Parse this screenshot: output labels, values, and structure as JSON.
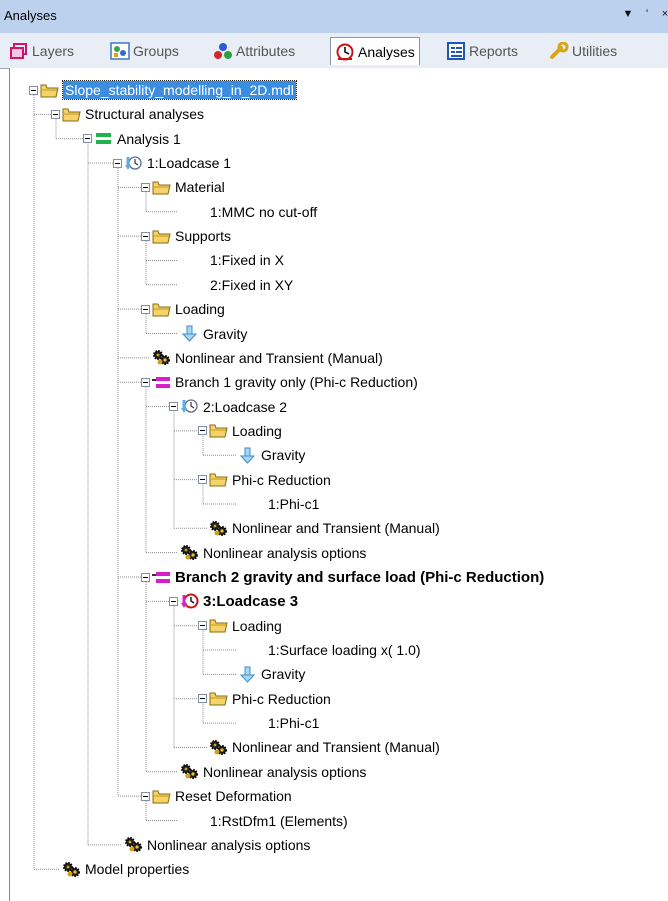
{
  "window": {
    "title": "Analyses",
    "buttons": [
      "▼",
      "'",
      "×"
    ]
  },
  "tabs": [
    {
      "label": "Layers",
      "icon": "layers-icon",
      "active": false
    },
    {
      "label": "Groups",
      "icon": "groups-icon",
      "active": false
    },
    {
      "label": "Attributes",
      "icon": "attributes-icon",
      "active": false
    },
    {
      "label": "Analyses",
      "icon": "analyses-icon",
      "active": true
    },
    {
      "label": "Reports",
      "icon": "reports-icon",
      "active": false
    },
    {
      "label": "Utilities",
      "icon": "utilities-icon",
      "active": false
    }
  ],
  "tree": [
    {
      "label": "Slope_stability_modelling_in_2D.mdl",
      "icon": "folder-icon",
      "expanded": true,
      "selected": true
    },
    {
      "label": "Structural analyses",
      "icon": "folder-icon",
      "expanded": true
    },
    {
      "label": "Analysis 1",
      "icon": "analysis-icon",
      "expanded": true
    },
    {
      "label": "1:Loadcase 1",
      "icon": "loadcase-icon",
      "expanded": true
    },
    {
      "label": "Material",
      "icon": "folder-icon",
      "expanded": true
    },
    {
      "label": "1:MMC no cut-off",
      "icon": "none"
    },
    {
      "label": "Supports",
      "icon": "folder-icon",
      "expanded": true
    },
    {
      "label": "1:Fixed in X",
      "icon": "none"
    },
    {
      "label": "2:Fixed in XY",
      "icon": "none"
    },
    {
      "label": "Loading",
      "icon": "folder-icon",
      "expanded": true
    },
    {
      "label": "Gravity",
      "icon": "gravity-icon"
    },
    {
      "label": "Nonlinear and Transient (Manual)",
      "icon": "gears-icon"
    },
    {
      "label": "Branch 1 gravity only (Phi-c Reduction)",
      "icon": "branch-icon",
      "expanded": true
    },
    {
      "label": "2:Loadcase 2",
      "icon": "loadcase-icon",
      "expanded": true
    },
    {
      "label": "Loading",
      "icon": "folder-icon",
      "expanded": true
    },
    {
      "label": "Gravity",
      "icon": "gravity-icon"
    },
    {
      "label": "Phi-c Reduction",
      "icon": "folder-icon",
      "expanded": true
    },
    {
      "label": "1:Phi-c1",
      "icon": "none"
    },
    {
      "label": "Nonlinear and Transient (Manual)",
      "icon": "gears-icon"
    },
    {
      "label": "Nonlinear analysis options",
      "icon": "gears-icon"
    },
    {
      "label": "Branch 2 gravity and surface load (Phi-c Reduction)",
      "icon": "branch-icon",
      "expanded": true,
      "bold": true
    },
    {
      "label": "3:Loadcase 3",
      "icon": "loadcase-active-icon",
      "expanded": true,
      "bold": true
    },
    {
      "label": "Loading",
      "icon": "folder-icon",
      "expanded": true
    },
    {
      "label": "1:Surface loading x( 1.0)",
      "icon": "none"
    },
    {
      "label": "Gravity",
      "icon": "gravity-icon"
    },
    {
      "label": "Phi-c Reduction",
      "icon": "folder-icon",
      "expanded": true
    },
    {
      "label": "1:Phi-c1",
      "icon": "none"
    },
    {
      "label": "Nonlinear and Transient (Manual)",
      "icon": "gears-icon"
    },
    {
      "label": "Nonlinear analysis options",
      "icon": "gears-icon"
    },
    {
      "label": "Reset Deformation",
      "icon": "folder-icon",
      "expanded": true
    },
    {
      "label": "1:RstDfm1 (Elements)",
      "icon": "none"
    },
    {
      "label": "Nonlinear analysis options",
      "icon": "gears-icon"
    },
    {
      "label": "Model properties",
      "icon": "gears-icon"
    }
  ],
  "colors": {
    "titlebar": "#bcd1ee",
    "tabstrip": "#e9eef6",
    "selection": "#3b8de0",
    "folder": "#e9c24a",
    "analysis": "#1fb34a",
    "branch": "#d91ec9",
    "gravity": "#6bb8e8"
  }
}
